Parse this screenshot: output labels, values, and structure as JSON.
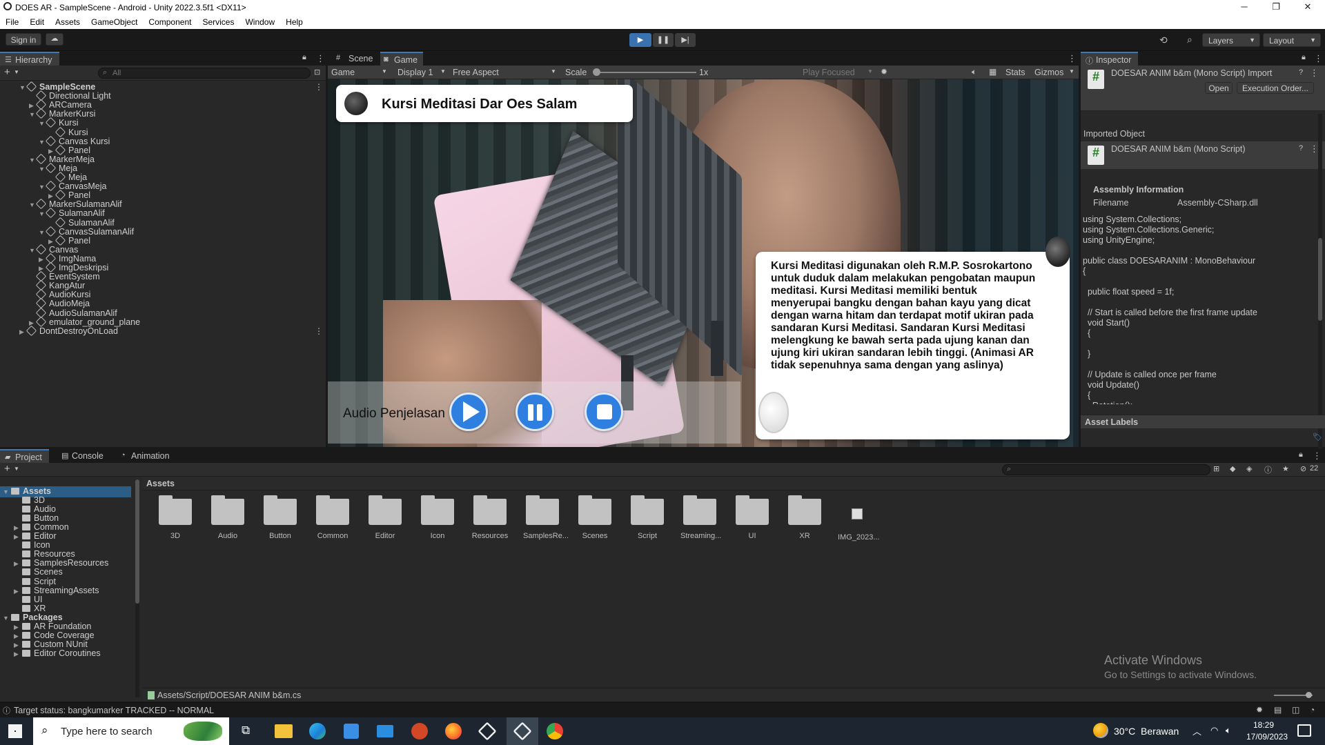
{
  "window": {
    "title": "DOES AR - SampleScene - Android - Unity 2022.3.5f1 <DX11>"
  },
  "menu": [
    "File",
    "Edit",
    "Assets",
    "GameObject",
    "Component",
    "Services",
    "Window",
    "Help"
  ],
  "toolbar": {
    "sign_in": "Sign in",
    "layers": "Layers",
    "layout": "Layout"
  },
  "hierarchy": {
    "tab": "Hierarchy",
    "search_placeholder": "All",
    "items": [
      {
        "label": "SampleScene",
        "depth": 0,
        "arrow": "▼",
        "bold": true
      },
      {
        "label": "Directional Light",
        "depth": 1,
        "arrow": ""
      },
      {
        "label": "ARCamera",
        "depth": 1,
        "arrow": "▶"
      },
      {
        "label": "MarkerKursi",
        "depth": 1,
        "arrow": "▼"
      },
      {
        "label": "Kursi",
        "depth": 2,
        "arrow": "▼"
      },
      {
        "label": "Kursi",
        "depth": 3,
        "arrow": ""
      },
      {
        "label": "Canvas Kursi",
        "depth": 2,
        "arrow": "▼"
      },
      {
        "label": "Panel",
        "depth": 3,
        "arrow": "▶"
      },
      {
        "label": "MarkerMeja",
        "depth": 1,
        "arrow": "▼"
      },
      {
        "label": "Meja",
        "depth": 2,
        "arrow": "▼"
      },
      {
        "label": "Meja",
        "depth": 3,
        "arrow": ""
      },
      {
        "label": "CanvasMeja",
        "depth": 2,
        "arrow": "▼"
      },
      {
        "label": "Panel",
        "depth": 3,
        "arrow": "▶"
      },
      {
        "label": "MarkerSulamanAlif",
        "depth": 1,
        "arrow": "▼"
      },
      {
        "label": "SulamanAlif",
        "depth": 2,
        "arrow": "▼"
      },
      {
        "label": "SulamanAlif",
        "depth": 3,
        "arrow": ""
      },
      {
        "label": "CanvasSulamanAlif",
        "depth": 2,
        "arrow": "▼"
      },
      {
        "label": "Panel",
        "depth": 3,
        "arrow": "▶"
      },
      {
        "label": "Canvas",
        "depth": 1,
        "arrow": "▼"
      },
      {
        "label": "ImgNama",
        "depth": 2,
        "arrow": "▶"
      },
      {
        "label": "ImgDeskripsi",
        "depth": 2,
        "arrow": "▶"
      },
      {
        "label": "EventSystem",
        "depth": 1,
        "arrow": ""
      },
      {
        "label": "KangAtur",
        "depth": 1,
        "arrow": ""
      },
      {
        "label": "AudioKursi",
        "depth": 1,
        "arrow": ""
      },
      {
        "label": "AudioMeja",
        "depth": 1,
        "arrow": ""
      },
      {
        "label": "AudioSulamanAlif",
        "depth": 1,
        "arrow": ""
      },
      {
        "label": "emulator_ground_plane",
        "depth": 1,
        "arrow": "▶"
      },
      {
        "label": "DontDestroyOnLoad",
        "depth": 0,
        "arrow": "▶"
      }
    ]
  },
  "game_view": {
    "tabs": [
      "Scene",
      "Game"
    ],
    "display_mode": "Game",
    "display": "Display 1",
    "aspect": "Free Aspect",
    "scale_label": "Scale",
    "scale_value": "1x",
    "play_mode": "Play Focused",
    "stats": "Stats",
    "gizmos": "Gizmos",
    "title_card": "Kursi Meditasi Dar Oes Salam",
    "description": "Kursi Meditasi digunakan oleh R.M.P. Sosrokartono untuk duduk dalam melakukan pengobatan maupun meditasi. Kursi Meditasi memiliki bentuk menyerupai bangku dengan bahan kayu yang dicat dengan warna hitam dan terdapat motif ukiran pada sandaran Kursi Meditasi. Sandaran Kursi Meditasi melengkung ke bawah serta pada ujung kanan dan ujung kiri ukiran sandaran lebih tinggi. (Animasi AR tidak sepenuhnya sama dengan yang aslinya)",
    "audio_label": "Audio Penjelasan"
  },
  "inspector": {
    "tab": "Inspector",
    "header_title": "DOESAR ANIM b&m (Mono Script) Import",
    "open": "Open",
    "execution_order": "Execution Order...",
    "imported_object": "Imported Object",
    "script_name": "DOESAR ANIM b&m (Mono Script)",
    "assembly_info": "Assembly Information",
    "filename_label": "Filename",
    "filename_value": "Assembly-CSharp.dll",
    "code": "using System.Collections;\nusing System.Collections.Generic;\nusing UnityEngine;\n\npublic class DOESARANIM : MonoBehaviour\n{\n\n  public float speed = 1f;\n\n  // Start is called before the first frame update\n  void Start()\n  {\n\n  }\n\n  // Update is called once per frame\n  void Update()\n  {\n    Rotation();",
    "asset_labels": "Asset Labels"
  },
  "project": {
    "tabs": [
      "Project",
      "Console",
      "Animation"
    ],
    "breadcrumb": "Assets",
    "hidden_count": "22",
    "tree": [
      {
        "label": "Assets",
        "depth": 0,
        "arrow": "▼",
        "bold": true
      },
      {
        "label": "3D",
        "depth": 1,
        "arrow": ""
      },
      {
        "label": "Audio",
        "depth": 1,
        "arrow": ""
      },
      {
        "label": "Button",
        "depth": 1,
        "arrow": ""
      },
      {
        "label": "Common",
        "depth": 1,
        "arrow": "▶"
      },
      {
        "label": "Editor",
        "depth": 1,
        "arrow": "▶"
      },
      {
        "label": "Icon",
        "depth": 1,
        "arrow": ""
      },
      {
        "label": "Resources",
        "depth": 1,
        "arrow": ""
      },
      {
        "label": "SamplesResources",
        "depth": 1,
        "arrow": "▶"
      },
      {
        "label": "Scenes",
        "depth": 1,
        "arrow": ""
      },
      {
        "label": "Script",
        "depth": 1,
        "arrow": ""
      },
      {
        "label": "StreamingAssets",
        "depth": 1,
        "arrow": "▶"
      },
      {
        "label": "UI",
        "depth": 1,
        "arrow": ""
      },
      {
        "label": "XR",
        "depth": 1,
        "arrow": ""
      },
      {
        "label": "Packages",
        "depth": 0,
        "arrow": "▼",
        "bold": true
      },
      {
        "label": "AR Foundation",
        "depth": 1,
        "arrow": "▶"
      },
      {
        "label": "Code Coverage",
        "depth": 1,
        "arrow": "▶"
      },
      {
        "label": "Custom NUnit",
        "depth": 1,
        "arrow": "▶"
      },
      {
        "label": "Editor Coroutines",
        "depth": 1,
        "arrow": "▶"
      }
    ],
    "folders": [
      "3D",
      "Audio",
      "Button",
      "Common",
      "Editor",
      "Icon",
      "Resources",
      "SamplesRe...",
      "Scenes",
      "Script",
      "Streaming...",
      "UI",
      "XR",
      "IMG_2023..."
    ],
    "selected_path": "Assets/Script/DOESAR ANIM b&m.cs"
  },
  "status_bar": {
    "message": "Target status: bangkumarker TRACKED -- NORMAL"
  },
  "watermark": {
    "title": "Activate Windows",
    "subtitle": "Go to Settings to activate Windows."
  },
  "taskbar": {
    "search_placeholder": "Type here to search",
    "weather": "30°C  Berawan",
    "time": "18:29",
    "date": "17/09/2023"
  }
}
